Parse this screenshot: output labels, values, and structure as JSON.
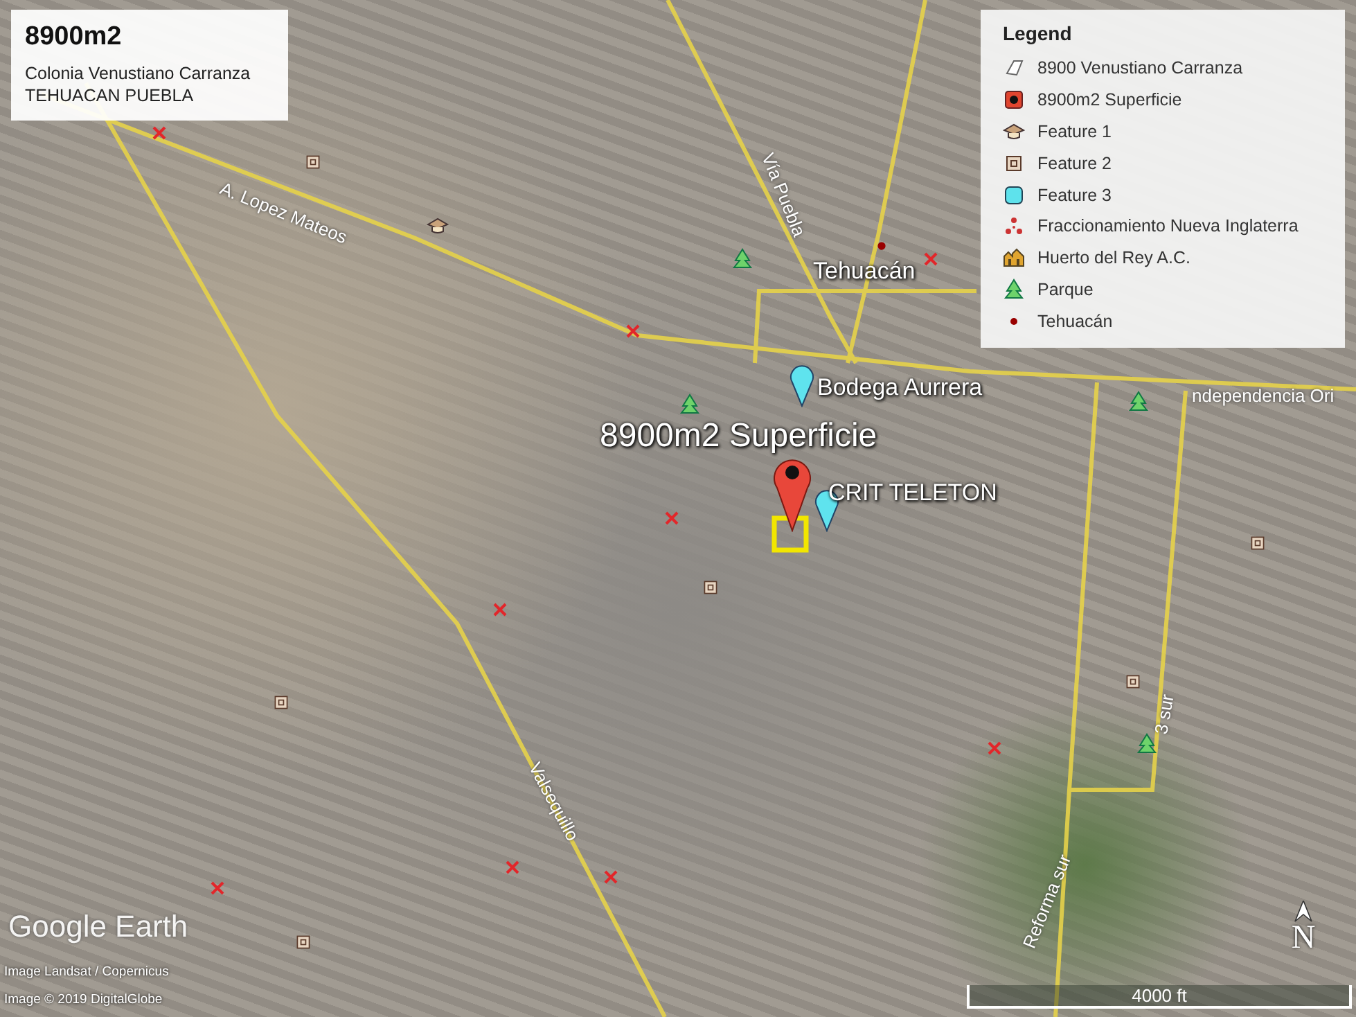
{
  "info_box": {
    "title": "8900m2",
    "lines": [
      "Colonia Venustiano Carranza",
      "TEHUACAN PUEBLA"
    ]
  },
  "legend": {
    "title": "Legend",
    "items": [
      {
        "kind": "polygon",
        "label": "8900 Venustiano Carranza"
      },
      {
        "kind": "red-square",
        "label": "8900m2 Superficie"
      },
      {
        "kind": "school",
        "label": "Feature 1"
      },
      {
        "kind": "square",
        "label": "Feature 2"
      },
      {
        "kind": "cyan-square",
        "label": "Feature 3"
      },
      {
        "kind": "cluster",
        "label": "Fraccionamiento Nueva Inglaterra"
      },
      {
        "kind": "building",
        "label": "Huerto del Rey A.C."
      },
      {
        "kind": "tree",
        "label": "Parque"
      },
      {
        "kind": "dot",
        "label": "Tehuacán"
      }
    ]
  },
  "placemark_labels": [
    {
      "kind": "small",
      "label": "Tehuacán"
    },
    {
      "kind": "small",
      "label": "Bodega Aurrera"
    },
    {
      "kind": "large",
      "label": "8900m2 Superficie"
    },
    {
      "kind": "small",
      "label": "CRIT TELETON"
    }
  ],
  "road_labels": [
    "A. Lopez Mateos",
    "Vía Puebla",
    "Valsequillo",
    "Reforma sur",
    "3 sur",
    "ndependencia Ori"
  ],
  "logo": "Google Earth",
  "attribution": [
    "Image Landsat / Copernicus",
    "Image © 2019 DigitalGlobe"
  ],
  "compass": "N",
  "scale": "4000 ft"
}
